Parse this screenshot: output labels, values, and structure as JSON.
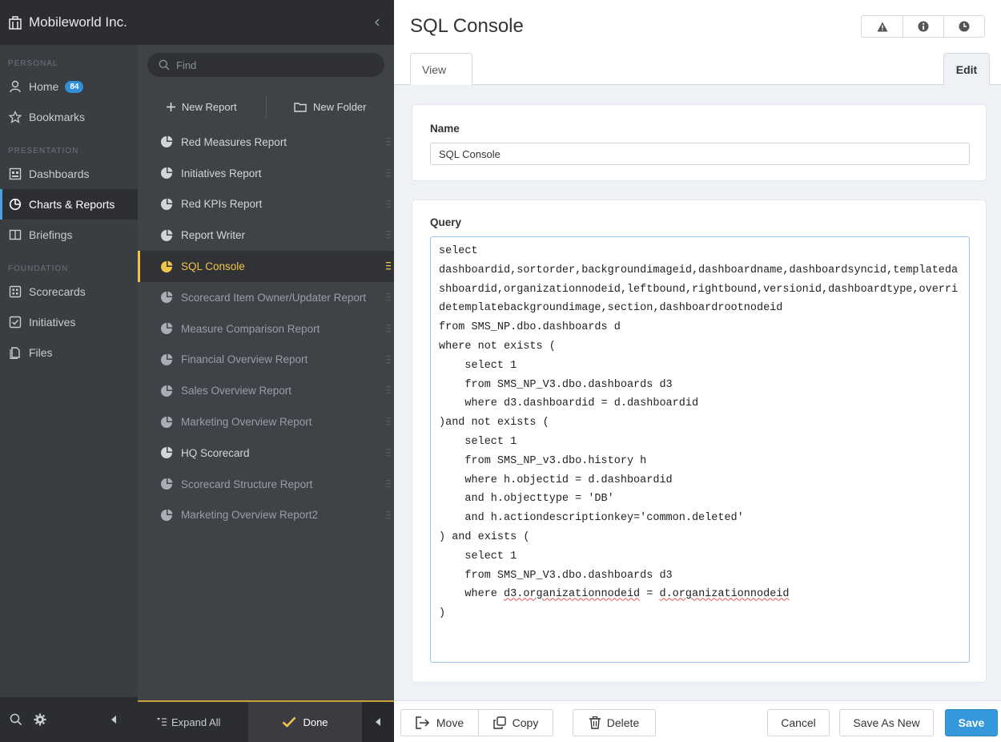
{
  "nav": {
    "org_name": "Mobileworld Inc.",
    "sections": [
      {
        "label": "PERSONAL"
      },
      {
        "label": "PRESENTATION"
      },
      {
        "label": "FOUNDATION"
      }
    ],
    "items": [
      {
        "label": "Home",
        "badge": "84",
        "icon": "user-icon"
      },
      {
        "label": "Bookmarks",
        "icon": "star-icon"
      },
      {
        "label": "Dashboards",
        "icon": "dashboard-icon"
      },
      {
        "label": "Charts & Reports",
        "icon": "pie-chart-icon",
        "active": true
      },
      {
        "label": "Briefings",
        "icon": "book-icon"
      },
      {
        "label": "Scorecards",
        "icon": "scorecard-icon"
      },
      {
        "label": "Initiatives",
        "icon": "checkbox-icon"
      },
      {
        "label": "Files",
        "icon": "files-icon"
      }
    ]
  },
  "list": {
    "search_placeholder": "Find",
    "new_report_label": "New Report",
    "new_folder_label": "New Folder",
    "reports": [
      {
        "label": "Red Measures Report"
      },
      {
        "label": "Initiatives Report"
      },
      {
        "label": "Red KPIs Report"
      },
      {
        "label": "Report Writer"
      },
      {
        "label": "SQL Console",
        "active": true
      },
      {
        "label": "Scorecard Item Owner/Updater Report",
        "dim": true
      },
      {
        "label": "Measure Comparison Report",
        "dim": true
      },
      {
        "label": "Financial Overview Report",
        "dim": true
      },
      {
        "label": "Sales Overview Report",
        "dim": true
      },
      {
        "label": "Marketing Overview Report",
        "dim": true
      },
      {
        "label": "HQ Scorecard"
      },
      {
        "label": "Scorecard Structure Report",
        "dim": true
      },
      {
        "label": "Marketing Overview Report2",
        "dim": true
      }
    ],
    "expand_all_label": "Expand All",
    "done_label": "Done"
  },
  "main": {
    "title": "SQL Console",
    "tabs": {
      "view": "View",
      "edit": "Edit"
    },
    "name_label": "Name",
    "name_value": "SQL Console",
    "query_label": "Query",
    "query_lines": [
      "select",
      "dashboardid,sortorder,backgroundimageid,dashboardname,dashboardsyncid,templatedashboardid,organizationnodeid,leftbound,rightbound,versionid,dashboardtype,overridetemplatebackgroundimage,section,dashboardrootnodeid",
      "from SMS_NP.dbo.dashboards d",
      "where not exists (",
      "    select 1",
      "    from SMS_NP_V3.dbo.dashboards d3",
      "    where d3.dashboardid = d.dashboardid",
      ")and not exists (",
      "    select 1",
      "    from SMS_NP_v3.dbo.history h",
      "    where h.objectid = d.dashboardid",
      "    and h.objecttype = 'DB'",
      "    and h.actiondescriptionkey='common.deleted'",
      ") and exists (",
      "    select 1",
      "    from SMS_NP_V3.dbo.dashboards d3",
      "    where ",
      ")"
    ],
    "query_spell_1": "d3.organizationnodeid",
    "query_mid": " = ",
    "query_spell_2": "d.organizationnodeid",
    "buttons": {
      "move": "Move",
      "copy": "Copy",
      "delete": "Delete",
      "cancel": "Cancel",
      "save_as_new": "Save As New",
      "save": "Save"
    }
  },
  "colors": {
    "accent": "#3498db",
    "active_report": "#f1c44a",
    "nav_bg": "#3a3d42"
  }
}
